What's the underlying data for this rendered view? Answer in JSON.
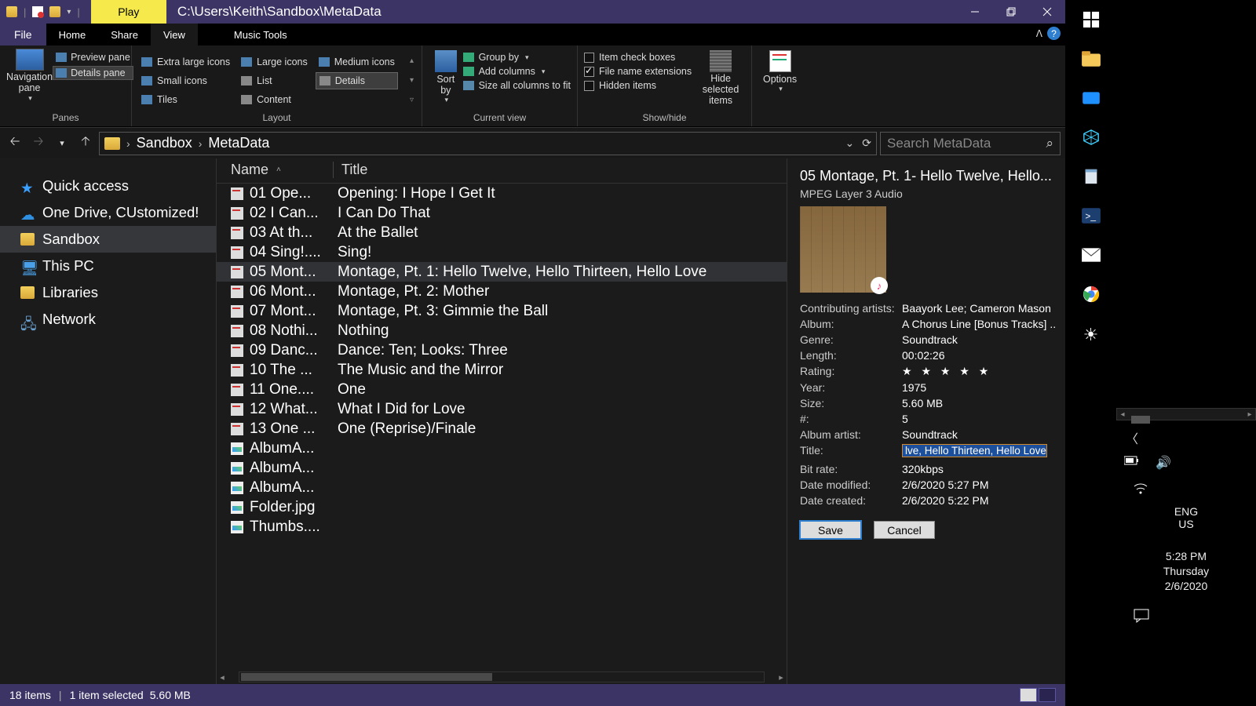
{
  "titlebar": {
    "context_tab": "Play",
    "path": "C:\\Users\\Keith\\Sandbox\\MetaData"
  },
  "tabs": {
    "file": "File",
    "home": "Home",
    "share": "Share",
    "view": "View",
    "music": "Music Tools"
  },
  "ribbon": {
    "panes": {
      "nav": "Navigation pane",
      "preview": "Preview pane",
      "details": "Details pane",
      "group": "Panes"
    },
    "layout": {
      "xl": "Extra large icons",
      "lg": "Large icons",
      "md": "Medium icons",
      "sm": "Small icons",
      "list": "List",
      "details": "Details",
      "tiles": "Tiles",
      "content": "Content",
      "group": "Layout"
    },
    "current": {
      "sort": "Sort by",
      "group_by": "Group by",
      "addcols": "Add columns",
      "sizecols": "Size all columns to fit",
      "group": "Current view"
    },
    "showhide": {
      "itemchk": "Item check boxes",
      "ext": "File name extensions",
      "hidden": "Hidden items",
      "hidesel": "Hide selected items",
      "group": "Show/hide"
    },
    "options": "Options"
  },
  "breadcrumbs": [
    "Sandbox",
    "MetaData"
  ],
  "search_placeholder": "Search MetaData",
  "tree": {
    "quick": "Quick access",
    "onedrive": "One Drive, CUstomized!",
    "sandbox": "Sandbox",
    "thispc": "This PC",
    "libraries": "Libraries",
    "network": "Network"
  },
  "columns": {
    "name": "Name",
    "title": "Title"
  },
  "files": [
    {
      "name": "01 Ope...",
      "title": "Opening: I Hope I Get It",
      "type": "audio"
    },
    {
      "name": "02 I Can...",
      "title": "I Can Do That",
      "type": "audio"
    },
    {
      "name": "03 At th...",
      "title": "At the Ballet",
      "type": "audio"
    },
    {
      "name": "04 Sing!....",
      "title": "Sing!",
      "type": "audio"
    },
    {
      "name": "05 Mont...",
      "title": "Montage, Pt. 1: Hello Twelve, Hello Thirteen, Hello Love",
      "type": "audio",
      "selected": true
    },
    {
      "name": "06 Mont...",
      "title": "Montage, Pt. 2: Mother",
      "type": "audio"
    },
    {
      "name": "07 Mont...",
      "title": "Montage, Pt. 3: Gimmie the Ball",
      "type": "audio"
    },
    {
      "name": "08 Nothi...",
      "title": "Nothing",
      "type": "audio"
    },
    {
      "name": "09 Danc...",
      "title": "Dance: Ten; Looks: Three",
      "type": "audio"
    },
    {
      "name": "10 The ...",
      "title": "The Music and the Mirror",
      "type": "audio"
    },
    {
      "name": "11 One....",
      "title": "One",
      "type": "audio"
    },
    {
      "name": "12 What...",
      "title": "What I Did for Love",
      "type": "audio"
    },
    {
      "name": "13 One ...",
      "title": "One (Reprise)/Finale",
      "type": "audio"
    },
    {
      "name": "AlbumA...",
      "title": "",
      "type": "image"
    },
    {
      "name": "AlbumA...",
      "title": "",
      "type": "image"
    },
    {
      "name": "AlbumA...",
      "title": "",
      "type": "image"
    },
    {
      "name": "Folder.jpg",
      "title": "",
      "type": "image"
    },
    {
      "name": "Thumbs....",
      "title": "",
      "type": "image"
    }
  ],
  "details": {
    "title": "05 Montage, Pt. 1- Hello Twelve, Hello...",
    "filetype": "MPEG Layer 3 Audio",
    "labels": {
      "artists": "Contributing artists:",
      "album": "Album:",
      "genre": "Genre:",
      "length": "Length:",
      "rating": "Rating:",
      "year": "Year:",
      "size": "Size:",
      "track": "#:",
      "aartist": "Album artist:",
      "ftitle": "Title:",
      "bitrate": "Bit rate:",
      "modified": "Date modified:",
      "created": "Date created:"
    },
    "values": {
      "artists": "Baayork Lee; Cameron Mason",
      "album": "A Chorus Line [Bonus Tracks] ...",
      "genre": "Soundtrack",
      "length": "00:02:26",
      "rating": "★ ★ ★ ★ ★",
      "year": "1975",
      "size": "5.60 MB",
      "track": "5",
      "aartist": "Soundtrack",
      "ftitle": "lve, Hello Thirteen, Hello Love",
      "bitrate": "320kbps",
      "modified": "2/6/2020 5:27 PM",
      "created": "2/6/2020 5:22 PM"
    },
    "save": "Save",
    "cancel": "Cancel"
  },
  "status": {
    "items": "18 items",
    "selected": "1 item selected",
    "size": "5.60 MB"
  },
  "tray": {
    "lang1": "ENG",
    "lang2": "US",
    "time": "5:28 PM",
    "day": "Thursday",
    "date": "2/6/2020"
  }
}
